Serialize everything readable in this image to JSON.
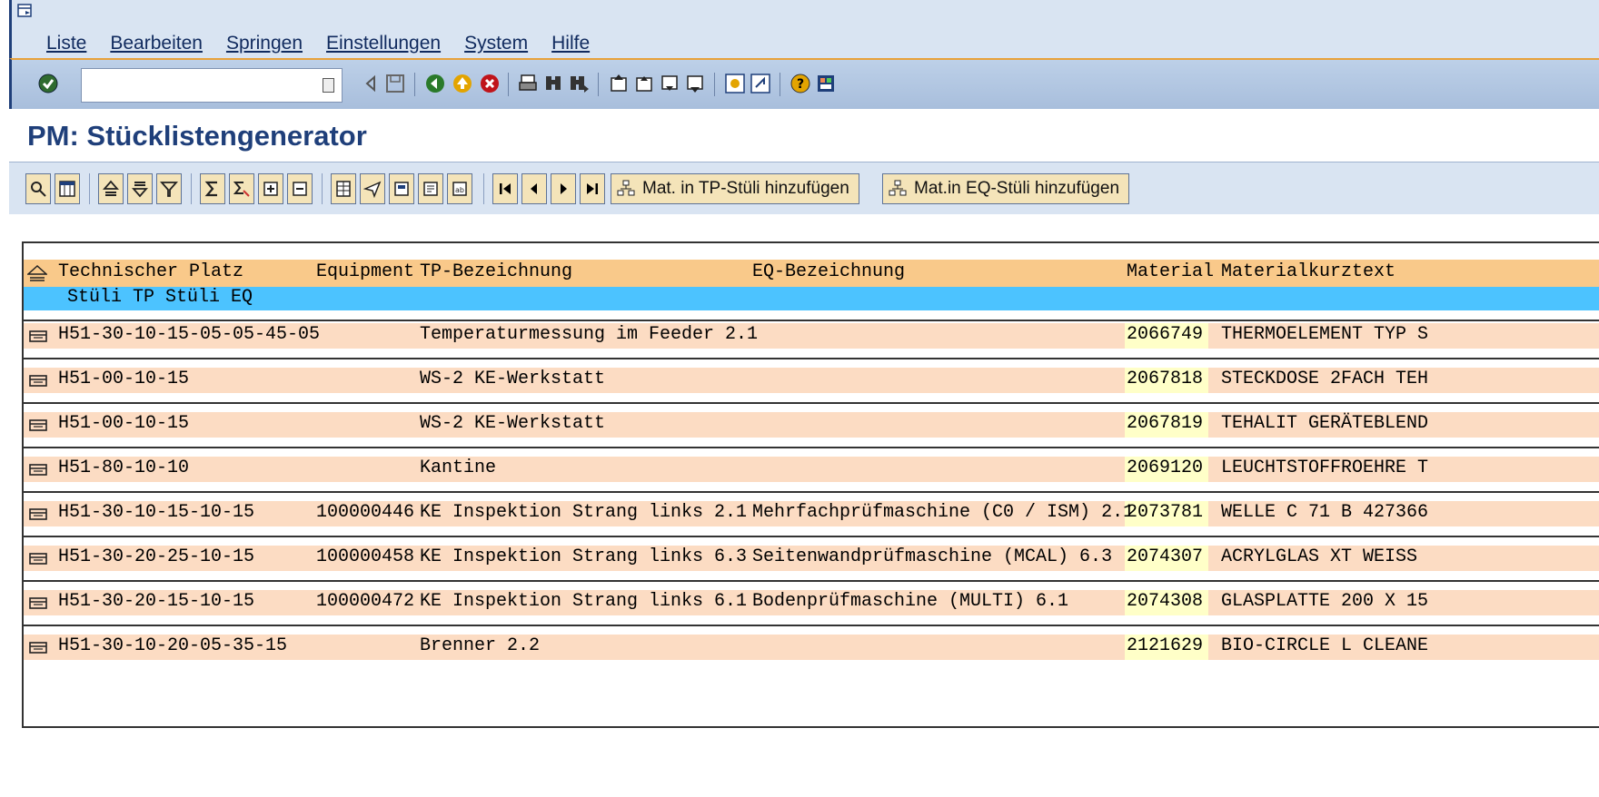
{
  "menubar": {
    "items": [
      "Liste",
      "Bearbeiten",
      "Springen",
      "Einstellungen",
      "System",
      "Hilfe"
    ]
  },
  "systoolbar": {
    "okcode_value": ""
  },
  "title": "PM: Stücklistengenerator",
  "apptoolbar": {
    "btn_tp_label": "Mat. in TP-Stüli hinzufügen",
    "btn_eq_label": "Mat.in EQ-Stüli hinzufügen"
  },
  "list": {
    "headers": {
      "tp": "Technischer Platz",
      "equipment": "Equipment",
      "tp_desc": "TP-Bezeichnung",
      "eq_desc": "EQ-Bezeichnung",
      "material": "Material",
      "mat_text": "Materialkurztext"
    },
    "subheader": "Stüli TP Stüli EQ",
    "rows": [
      {
        "tp": "H51-30-10-15-05-05-45-05",
        "equipment": "",
        "tp_desc": "Temperaturmessung im Feeder 2.1",
        "eq_desc": "",
        "material": "2066749",
        "mat_text": "THERMOELEMENT TYP S"
      },
      {
        "tp": "H51-00-10-15",
        "equipment": "",
        "tp_desc": "WS-2 KE-Werkstatt",
        "eq_desc": "",
        "material": "2067818",
        "mat_text": "STECKDOSE 2FACH TEH"
      },
      {
        "tp": "H51-00-10-15",
        "equipment": "",
        "tp_desc": "WS-2 KE-Werkstatt",
        "eq_desc": "",
        "material": "2067819",
        "mat_text": "TEHALIT GERÄTEBLEND"
      },
      {
        "tp": "H51-80-10-10",
        "equipment": "",
        "tp_desc": "Kantine",
        "eq_desc": "",
        "material": "2069120",
        "mat_text": "LEUCHTSTOFFROEHRE T"
      },
      {
        "tp": "H51-30-10-15-10-15",
        "equipment": "100000446",
        "tp_desc": "KE Inspektion Strang links 2.1",
        "eq_desc": "Mehrfachprüfmaschine (C0 / ISM) 2.1",
        "material": "2073781",
        "mat_text": "WELLE C 71 B 427366"
      },
      {
        "tp": "H51-30-20-25-10-15",
        "equipment": "100000458",
        "tp_desc": "KE Inspektion Strang links 6.3",
        "eq_desc": "Seitenwandprüfmaschine (MCAL) 6.3",
        "material": "2074307",
        "mat_text": "ACRYLGLAS XT WEISS"
      },
      {
        "tp": "H51-30-20-15-10-15",
        "equipment": "100000472",
        "tp_desc": "KE Inspektion Strang links 6.1",
        "eq_desc": "Bodenprüfmaschine (MULTI) 6.1",
        "material": "2074308",
        "mat_text": "GLASPLATTE 200 X 15"
      },
      {
        "tp": "H51-30-10-20-05-35-15",
        "equipment": "",
        "tp_desc": "Brenner 2.2",
        "eq_desc": "",
        "material": "2121629",
        "mat_text": "BIO-CIRCLE L CLEANE"
      }
    ]
  }
}
